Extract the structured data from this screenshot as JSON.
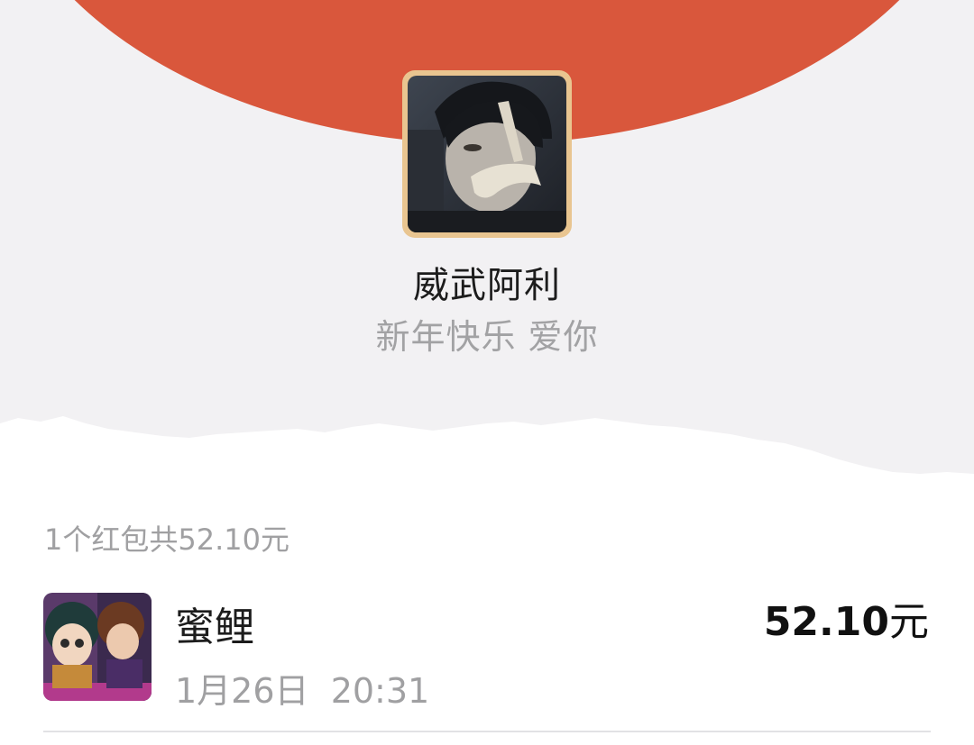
{
  "colors": {
    "accent_red": "#d9573c",
    "header_gray": "#f2f1f3",
    "avatar_border": "#e9c590",
    "text_primary": "#1c1c1c",
    "text_secondary": "#a0a0a2"
  },
  "sender": {
    "name": "威武阿利",
    "greeting": "新年快乐 爱你",
    "avatar_icon": "sender-avatar-photo"
  },
  "summary": {
    "text": "1个红包共52.10元"
  },
  "records": [
    {
      "name": "蜜鲤",
      "time": "1月26日  20:31",
      "amount": "52.10",
      "unit": "元",
      "avatar_icon": "receiver-avatar-anime"
    }
  ]
}
